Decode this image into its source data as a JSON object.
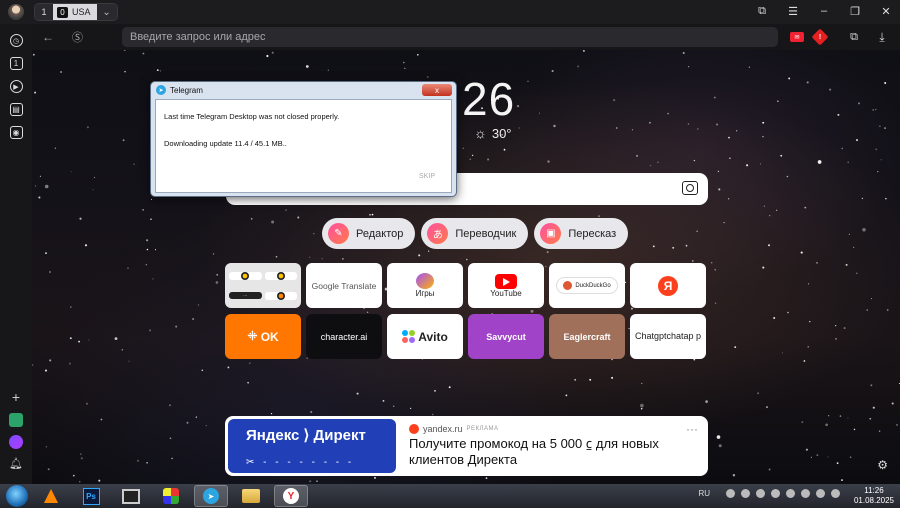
{
  "tabbar": {
    "tab_count": "1",
    "active_tab_badge": "0",
    "active_tab_label": "USA"
  },
  "sidebar": {
    "tabs_count": "1"
  },
  "address_bar": {
    "placeholder": "Введите запрос или адрес"
  },
  "clock": "26",
  "weather": {
    "temperature": "30°",
    "icon": "sun-icon"
  },
  "quick_actions": [
    {
      "label": "Редактор",
      "icon": "edit-icon"
    },
    {
      "label": "Переводчик",
      "icon": "translate-icon"
    },
    {
      "label": "Пересказ",
      "icon": "summary-icon"
    }
  ],
  "tiles": [
    {
      "label": "",
      "type": "multi"
    },
    {
      "label": "Google Translate"
    },
    {
      "label": "Игры"
    },
    {
      "label": "YouTube"
    },
    {
      "label": "DuckDuckGo"
    },
    {
      "label": "Я"
    },
    {
      "label": "OK"
    },
    {
      "label": "character.ai"
    },
    {
      "label": "Avito"
    },
    {
      "label": "Savvycut"
    },
    {
      "label": "Eaglercraft"
    },
    {
      "label": "Chatgptchatap p"
    }
  ],
  "ad": {
    "banner_title": "Яндекс ⟩ Директ",
    "source": "yandex.ru",
    "tag": "РЕКЛАМА",
    "text": "Получите промокод на 5 000 ⃀ для новых клиентов Директа",
    "more": "···"
  },
  "telegram_dialog": {
    "title": "Telegram",
    "line1": "Last time Telegram Desktop was not closed properly.",
    "line2": "Downloading update 11.4 / 45.1 MB..",
    "skip": "SKIP",
    "close": "x"
  },
  "taskbar": {
    "lang": "RU",
    "time": "11:26",
    "date": "01.08.2025"
  },
  "colors": {
    "accent_red": "#fc3f1d",
    "ok_orange": "#ff7700",
    "savvycut_purple": "#a043c8",
    "eaglercraft_brown": "#a0705a",
    "direct_blue": "#2140b8"
  }
}
